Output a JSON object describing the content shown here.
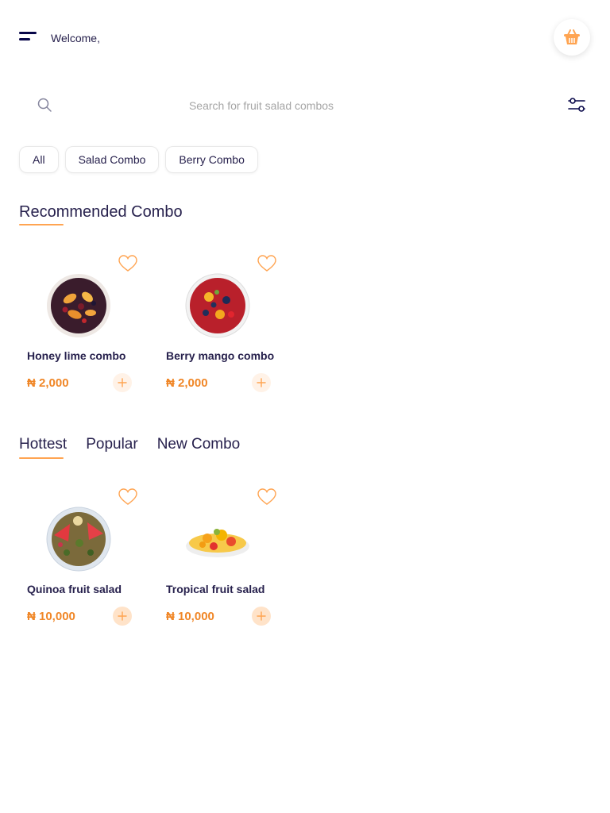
{
  "header": {
    "welcome_text": "Welcome,"
  },
  "search": {
    "placeholder": "Search for fruit salad combos"
  },
  "chips": [
    "All",
    "Salad Combo",
    "Berry Combo"
  ],
  "recommended": {
    "title": "Recommended Combo",
    "items": [
      {
        "name": "Honey lime combo",
        "price": "₦ 2,000"
      },
      {
        "name": "Berry mango combo",
        "price": "₦ 2,000"
      }
    ]
  },
  "tabs": [
    "Hottest",
    "Popular",
    "New Combo"
  ],
  "hottest": {
    "items": [
      {
        "name": "Quinoa fruit salad",
        "price": "₦ 10,000"
      },
      {
        "name": "Tropical fruit salad",
        "price": "₦ 10,000"
      }
    ]
  },
  "colors": {
    "accent": "#FFA451",
    "price": "#F08626",
    "text": "#27214D"
  }
}
